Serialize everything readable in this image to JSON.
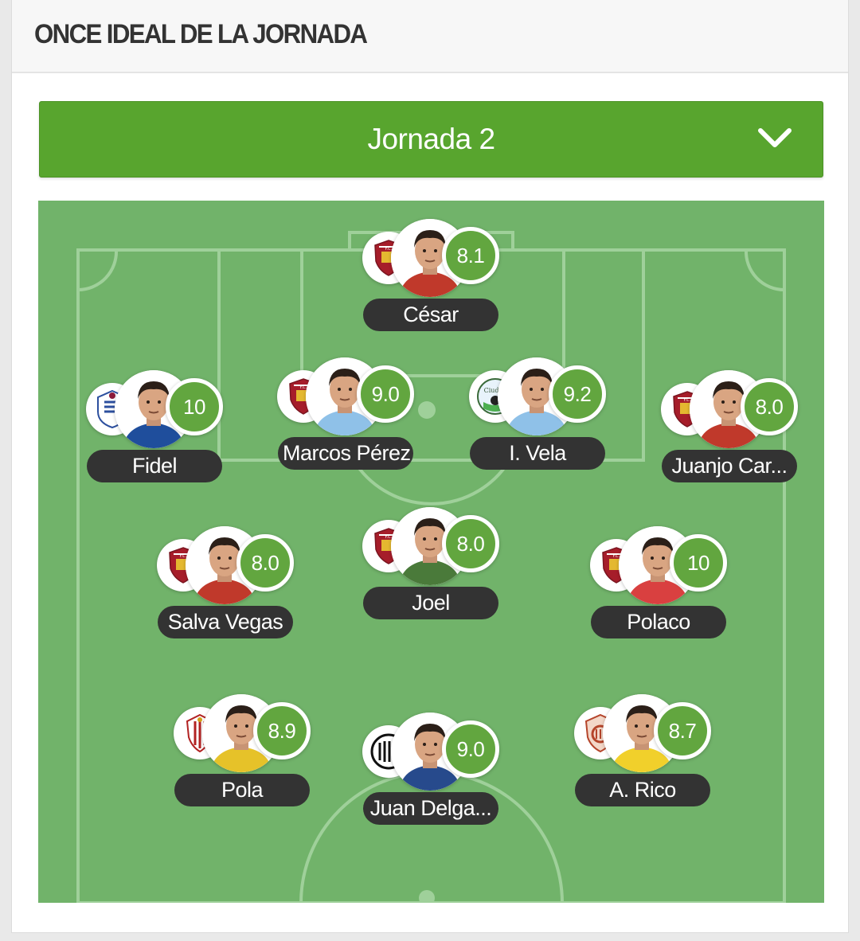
{
  "header": {
    "title": "ONCE IDEAL DE LA JORNADA"
  },
  "selector": {
    "label": "Jornada 2",
    "icon": "chevron-down-icon"
  },
  "colors": {
    "accent_green": "#58a52e",
    "pitch_green": "#71b36a",
    "score_green": "#62a63f",
    "name_bg": "#333333"
  },
  "players": [
    {
      "name": "César",
      "score": "8.1",
      "crest": "red-shield-crest",
      "kit": "#c0392b"
    },
    {
      "name": "Fidel",
      "score": "10",
      "crest": "blue-white-crest",
      "kit": "#1f4e9c"
    },
    {
      "name": "Marcos Pérez",
      "score": "9.0",
      "crest": "red-shield-crest",
      "kit": "#8fc1e8"
    },
    {
      "name": "I. Vela",
      "score": "9.2",
      "crest": "round-ball-crest",
      "kit": "#8fc1e8"
    },
    {
      "name": "Juanjo Car...",
      "score": "8.0",
      "crest": "red-shield-crest",
      "kit": "#c0392b"
    },
    {
      "name": "Salva Vegas",
      "score": "8.0",
      "crest": "red-shield-crest",
      "kit": "#c0392b"
    },
    {
      "name": "Joel",
      "score": "8.0",
      "crest": "red-shield-crest",
      "kit": "#4a7a3a"
    },
    {
      "name": "Polaco",
      "score": "10",
      "crest": "red-shield-crest",
      "kit": "#d94040"
    },
    {
      "name": "Pola",
      "score": "8.9",
      "crest": "red-white-crest",
      "kit": "#e6c229"
    },
    {
      "name": "Juan Delga...",
      "score": "9.0",
      "crest": "black-white-crest",
      "kit": "#274a8c"
    },
    {
      "name": "A. Rico",
      "score": "8.7",
      "crest": "orange-crest",
      "kit": "#f1d02b"
    }
  ]
}
